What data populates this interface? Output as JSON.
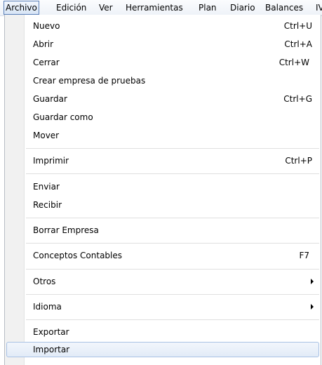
{
  "menubar": {
    "items": [
      "Archivo",
      "Edición",
      "Ver",
      "Herramientas",
      "Plan",
      "Diario",
      "Balances",
      "IV"
    ]
  },
  "menu": {
    "items": [
      {
        "label": "Nuevo",
        "shortcut": "Ctrl+U"
      },
      {
        "label": "Abrir",
        "shortcut": "Ctrl+A"
      },
      {
        "label": "Cerrar",
        "shortcut": "Ctrl+W"
      },
      {
        "label": "Crear empresa de pruebas",
        "shortcut": ""
      },
      {
        "label": "Guardar",
        "shortcut": "Ctrl+G"
      },
      {
        "label": "Guardar como",
        "shortcut": ""
      },
      {
        "label": "Mover",
        "shortcut": ""
      },
      {
        "label": "Imprimir",
        "shortcut": "Ctrl+P"
      },
      {
        "label": "Enviar",
        "shortcut": ""
      },
      {
        "label": "Recibir",
        "shortcut": ""
      },
      {
        "label": "Borrar Empresa",
        "shortcut": ""
      },
      {
        "label": "Conceptos Contables",
        "shortcut": "F7"
      },
      {
        "label": "Otros",
        "submenu": true
      },
      {
        "label": "Idioma",
        "submenu": true
      },
      {
        "label": "Exportar",
        "shortcut": ""
      },
      {
        "label": "Importar",
        "shortcut": "",
        "highlighted": true
      }
    ]
  }
}
